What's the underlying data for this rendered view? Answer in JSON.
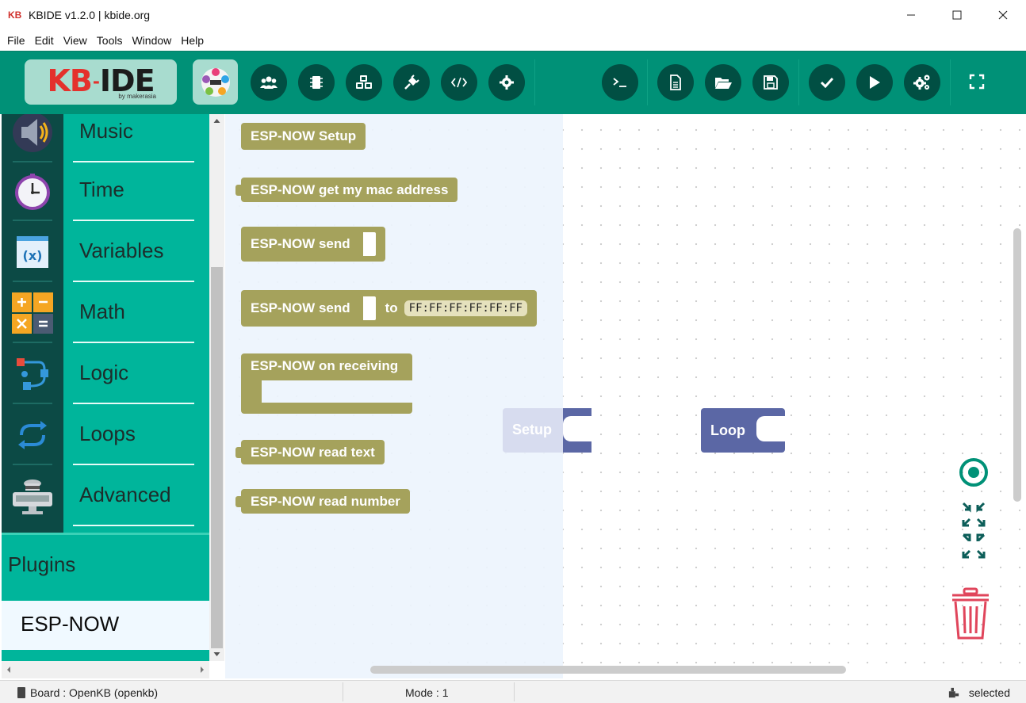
{
  "window": {
    "title": "KBIDE v1.2.0 | kbide.org",
    "app_logo_text": "KB",
    "controls": {
      "minimize": "—",
      "maximize": "☐",
      "close": "✕"
    }
  },
  "menu": [
    "File",
    "Edit",
    "View",
    "Tools",
    "Window",
    "Help"
  ],
  "brand": {
    "kb": "KB",
    "ide": "IDE",
    "byline": "by makerasia"
  },
  "toolbar": {
    "left_icons": [
      "community-icon",
      "board-icon",
      "plugins-icon",
      "port-icon",
      "code-icon",
      "settings-icon"
    ],
    "right_icons": [
      "terminal-icon",
      "new-file-icon",
      "open-folder-icon",
      "save-icon",
      "compile-check-icon",
      "run-icon",
      "advanced-settings-icon",
      "fullscreen-icon"
    ],
    "accent_color": "#009177",
    "button_color": "#014f43"
  },
  "categories": [
    {
      "label": "Music",
      "icon": "speaker-icon"
    },
    {
      "label": "Time",
      "icon": "clock-icon"
    },
    {
      "label": "Variables",
      "icon": "variable-icon"
    },
    {
      "label": "Math",
      "icon": "calculator-icon"
    },
    {
      "label": "Logic",
      "icon": "logic-icon"
    },
    {
      "label": "Loops",
      "icon": "loop-icon"
    },
    {
      "label": "Advanced",
      "icon": "advanced-icon"
    }
  ],
  "plugins": {
    "label": "Plugins",
    "selected": "ESP-NOW"
  },
  "flyout_blocks": {
    "setup": "ESP-NOW Setup",
    "get_mac": "ESP-NOW get my mac address",
    "send": "ESP-NOW send",
    "send_to": "ESP-NOW send",
    "send_to_word": "to",
    "send_to_mac": "FF:FF:FF:FF:FF:FF",
    "on_receiving": "ESP-NOW on receiving",
    "read_text": "ESP-NOW read text",
    "read_number": "ESP-NOW read number",
    "block_color": "#a5a25c"
  },
  "workspace_blocks": {
    "setup": "Setup",
    "loop": "Loop",
    "block_color": "#5b67a5"
  },
  "workspace_controls": {
    "recenter": "target-icon",
    "zoom": "zoom-to-fit-icon",
    "trash": "trash-icon"
  },
  "status": {
    "board": "Board : OpenKB (openkb)",
    "mode": "Mode : 1",
    "selected": "selected"
  }
}
